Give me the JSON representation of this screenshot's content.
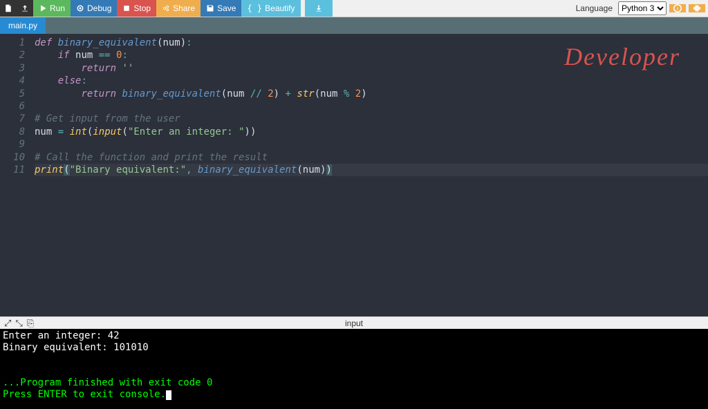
{
  "toolbar": {
    "run": "Run",
    "debug": "Debug",
    "stop": "Stop",
    "share": "Share",
    "save": "Save",
    "beautify": "Beautify",
    "language_label": "Language",
    "language_value": "Python 3"
  },
  "tabs": {
    "main": "main.py"
  },
  "code": {
    "lines": [
      {
        "n": 1,
        "tokens": [
          [
            "kw",
            "def "
          ],
          [
            "fn",
            "binary_equivalent"
          ],
          [
            "paren",
            "("
          ],
          [
            "id",
            "num"
          ],
          [
            "paren",
            ")"
          ],
          [
            "op",
            ":"
          ]
        ]
      },
      {
        "n": 2,
        "tokens": [
          [
            "",
            "    "
          ],
          [
            "kw",
            "if"
          ],
          [
            "",
            " "
          ],
          [
            "id",
            "num"
          ],
          [
            "",
            " "
          ],
          [
            "op",
            "=="
          ],
          [
            "",
            " "
          ],
          [
            "num",
            "0"
          ],
          [
            "op",
            ":"
          ]
        ]
      },
      {
        "n": 3,
        "tokens": [
          [
            "",
            "        "
          ],
          [
            "kw",
            "return"
          ],
          [
            "",
            " "
          ],
          [
            "str",
            "''"
          ]
        ]
      },
      {
        "n": 4,
        "tokens": [
          [
            "",
            "    "
          ],
          [
            "kw",
            "else"
          ],
          [
            "op",
            ":"
          ]
        ]
      },
      {
        "n": 5,
        "tokens": [
          [
            "",
            "        "
          ],
          [
            "kw",
            "return"
          ],
          [
            "",
            " "
          ],
          [
            "fn",
            "binary_equivalent"
          ],
          [
            "paren",
            "("
          ],
          [
            "id",
            "num"
          ],
          [
            "",
            " "
          ],
          [
            "op",
            "//"
          ],
          [
            "",
            " "
          ],
          [
            "num",
            "2"
          ],
          [
            "paren",
            ")"
          ],
          [
            "",
            " "
          ],
          [
            "op",
            "+"
          ],
          [
            "",
            " "
          ],
          [
            "builtin",
            "str"
          ],
          [
            "paren",
            "("
          ],
          [
            "id",
            "num"
          ],
          [
            "",
            " "
          ],
          [
            "op",
            "%"
          ],
          [
            "",
            " "
          ],
          [
            "num",
            "2"
          ],
          [
            "paren",
            ")"
          ]
        ]
      },
      {
        "n": 6,
        "tokens": []
      },
      {
        "n": 7,
        "tokens": [
          [
            "cmt",
            "# Get input from the user"
          ]
        ]
      },
      {
        "n": 8,
        "tokens": [
          [
            "id",
            "num"
          ],
          [
            "",
            " "
          ],
          [
            "op",
            "="
          ],
          [
            "",
            " "
          ],
          [
            "builtin",
            "int"
          ],
          [
            "paren",
            "("
          ],
          [
            "builtin",
            "input"
          ],
          [
            "paren",
            "("
          ],
          [
            "str",
            "\"Enter an integer: \""
          ],
          [
            "paren",
            ")"
          ],
          [
            "paren",
            ")"
          ]
        ]
      },
      {
        "n": 9,
        "tokens": []
      },
      {
        "n": 10,
        "tokens": [
          [
            "cmt",
            "# Call the function and print the result"
          ]
        ]
      },
      {
        "n": 11,
        "tokens": [
          [
            "builtin",
            "print"
          ],
          [
            "paren hl",
            "("
          ],
          [
            "str",
            "\"Binary equivalent:\""
          ],
          [
            "op",
            ","
          ],
          [
            "",
            " "
          ],
          [
            "fn",
            "binary_equivalent"
          ],
          [
            "paren",
            "("
          ],
          [
            "id",
            "num"
          ],
          [
            "paren",
            ")"
          ],
          [
            "paren hl",
            ")"
          ]
        ]
      }
    ],
    "active_line": 11
  },
  "annotation": "Developer",
  "console": {
    "header_label": "input",
    "lines": [
      {
        "cls": "white",
        "text": "Enter an integer: 42"
      },
      {
        "cls": "white",
        "text": "Binary equivalent: 101010"
      },
      {
        "cls": "",
        "text": ""
      },
      {
        "cls": "",
        "text": ""
      },
      {
        "cls": "green",
        "text": "...Program finished with exit code 0"
      },
      {
        "cls": "green",
        "text": "Press ENTER to exit console.",
        "cursor": true
      }
    ]
  }
}
